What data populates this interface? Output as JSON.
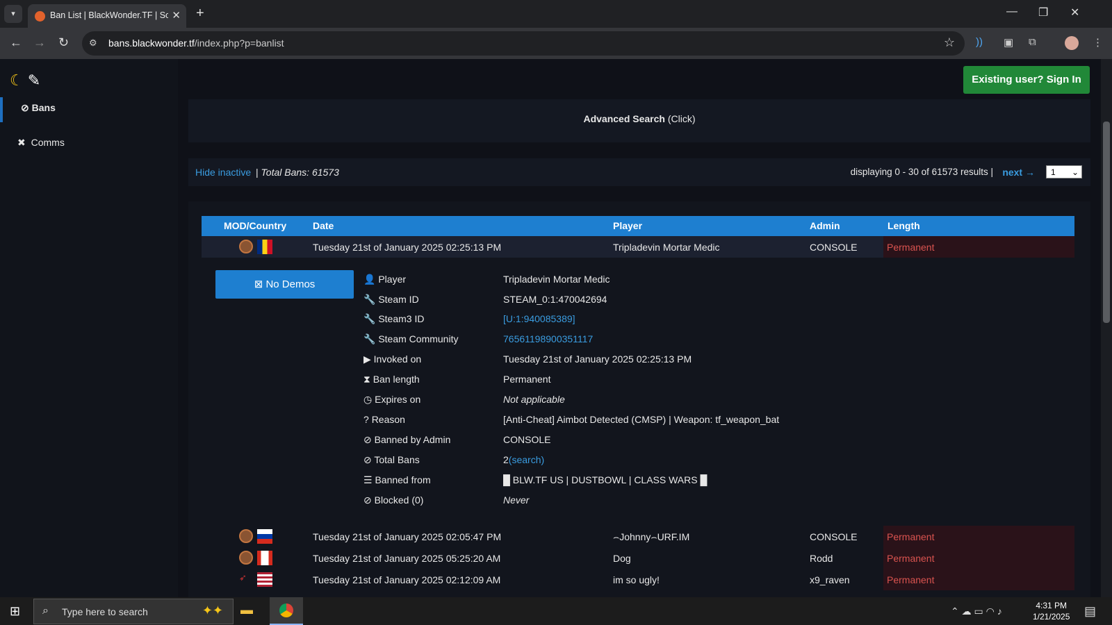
{
  "browser": {
    "tab_title": "Ban List | BlackWonder.TF | Sou",
    "url_host": "bans.blackwonder.tf",
    "url_path": "/index.php?p=banlist"
  },
  "sidebar": {
    "items": [
      {
        "label": "Bans",
        "icon": "ban-icon",
        "active": true
      },
      {
        "label": "Comms",
        "icon": "mute-icon",
        "active": false
      }
    ]
  },
  "header": {
    "signin_label": "Existing user? Sign In"
  },
  "advanced_search": {
    "bold": "Advanced Search",
    "rest": " (Click)"
  },
  "infobar": {
    "hide_inactive": "Hide inactive",
    "separator": " | ",
    "total_bans": "Total Bans: 61573",
    "displaying": "displaying 0 - 30 of 61573 results |",
    "next": "next",
    "page_selected": "1"
  },
  "table": {
    "headers": [
      "MOD/Country",
      "Date",
      "Player",
      "Admin",
      "Length"
    ],
    "rows": [
      {
        "date": "Tuesday 21st of January 2025 02:25:13 PM",
        "player": "Tripladevin Mortar Medic",
        "admin": "CONSOLE",
        "length": "Permanent",
        "flag": "romania"
      },
      {
        "date": "Tuesday 21st of January 2025 02:05:47 PM",
        "player": "⌢Johnny⌢URF.IM",
        "admin": "CONSOLE",
        "length": "Permanent",
        "flag": "russia"
      },
      {
        "date": "Tuesday 21st of January 2025 05:25:20 AM",
        "player": "Dog",
        "admin": "Rodd",
        "length": "Permanent",
        "flag": "canada"
      },
      {
        "date": "Tuesday 21st of January 2025 02:12:09 AM",
        "player": "im so ugly!",
        "admin": "x9_raven",
        "length": "Permanent",
        "flag": "usa"
      }
    ]
  },
  "details": {
    "no_demos": "No Demos",
    "fields": [
      {
        "label": "Player",
        "value": "Tripladevin Mortar Medic",
        "icon": "user-icon"
      },
      {
        "label": "Steam ID",
        "value": "STEAM_0:1:470042694",
        "icon": "wrench-icon"
      },
      {
        "label": "Steam3 ID",
        "value": "[U:1:940085389]",
        "icon": "wrench-icon"
      },
      {
        "label": "Steam Community",
        "value": "76561198900351117",
        "icon": "wrench-icon"
      },
      {
        "label": "Invoked on",
        "value": "Tuesday 21st of January 2025 02:25:13 PM",
        "icon": "play-icon"
      },
      {
        "label": "Ban length",
        "value": "Permanent",
        "icon": "hourglass-icon"
      },
      {
        "label": "Expires on",
        "value": "Not applicable",
        "icon": "clock-icon"
      },
      {
        "label": "Reason",
        "value": "[Anti-Cheat] Aimbot Detected (CMSP) | Weapon: tf_weapon_bat",
        "icon": "question-icon"
      },
      {
        "label": "Banned by Admin",
        "value": "CONSOLE",
        "icon": "ban-icon"
      },
      {
        "label": "Total Bans",
        "value": "2",
        "link": "(search)",
        "icon": "ban-icon"
      },
      {
        "label": "Banned from",
        "value": "█ BLW.TF US | DUSTBOWL | CLASS WARS █",
        "icon": "server-icon"
      },
      {
        "label": "Blocked (0)",
        "value": "Never",
        "icon": "ban-icon"
      }
    ]
  },
  "taskbar": {
    "search_placeholder": "Type here to search",
    "time": "4:31 PM",
    "date": "1/21/2025"
  },
  "colors": {
    "accent": "#1e7fd0",
    "permanent": "#d9534f",
    "signin": "#218838"
  }
}
